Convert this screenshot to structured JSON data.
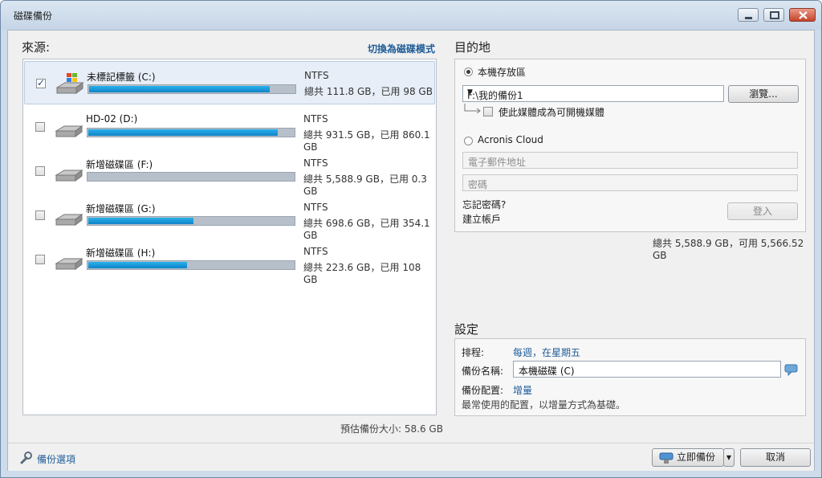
{
  "window": {
    "title": "磁碟備份"
  },
  "source": {
    "heading": "來源:",
    "switch_mode": "切換為磁碟模式",
    "drives": [
      {
        "name": "未標記標籤 (C:)",
        "fs": "NTFS",
        "size": "總共 111.8 GB，已用 98 GB",
        "checked": true,
        "used_fraction": 0.88,
        "icon": "system-drive-icon"
      },
      {
        "name": "HD-02 (D:)",
        "fs": "NTFS",
        "size": "總共 931.5 GB，已用 860.1 GB",
        "checked": false,
        "used_fraction": 0.92,
        "icon": "hard-drive-icon"
      },
      {
        "name": "新增磁碟區 (F:)",
        "fs": "NTFS",
        "size": "總共 5,588.9 GB，已用 0.3 GB",
        "checked": false,
        "used_fraction": 0.0,
        "icon": "hard-drive-icon"
      },
      {
        "name": "新增磁碟區 (G:)",
        "fs": "NTFS",
        "size": "總共 698.6 GB，已用 354.1 GB",
        "checked": false,
        "used_fraction": 0.51,
        "icon": "hard-drive-icon"
      },
      {
        "name": "新增磁碟區 (H:)",
        "fs": "NTFS",
        "size": "總共 223.6 GB，已用 108 GB",
        "checked": false,
        "used_fraction": 0.48,
        "icon": "hard-drive-icon"
      }
    ],
    "estimate": "預估備份大小: 58.6 GB"
  },
  "destination": {
    "heading": "目的地",
    "local_label": "本機存放區",
    "path": "F:\\我的備份1",
    "browse": "瀏覽...",
    "bootable_label": "使此媒體成為可開機媒體",
    "cloud_label": "Acronis Cloud",
    "email_placeholder": "電子郵件地址",
    "password_placeholder": "密碼",
    "forgot": "忘記密碼?",
    "create_account": "建立帳戶",
    "login": "登入",
    "total": "總共 5,588.9 GB，可用 5,566.52 GB"
  },
  "settings": {
    "heading": "設定",
    "schedule_label": "排程:",
    "schedule_value": "每週，在星期五",
    "name_label": "備份名稱:",
    "name_value": "本機磁碟 (C)",
    "scheme_label": "備份配置:",
    "scheme_value": "增量",
    "scheme_desc": "最常使用的配置，以增量方式為基礎。"
  },
  "footer": {
    "options": "備份選項",
    "backup_now": "立即備份",
    "cancel": "取消"
  },
  "colors": {
    "accent": "#1f5c98",
    "progress": "#1a9ad8"
  }
}
